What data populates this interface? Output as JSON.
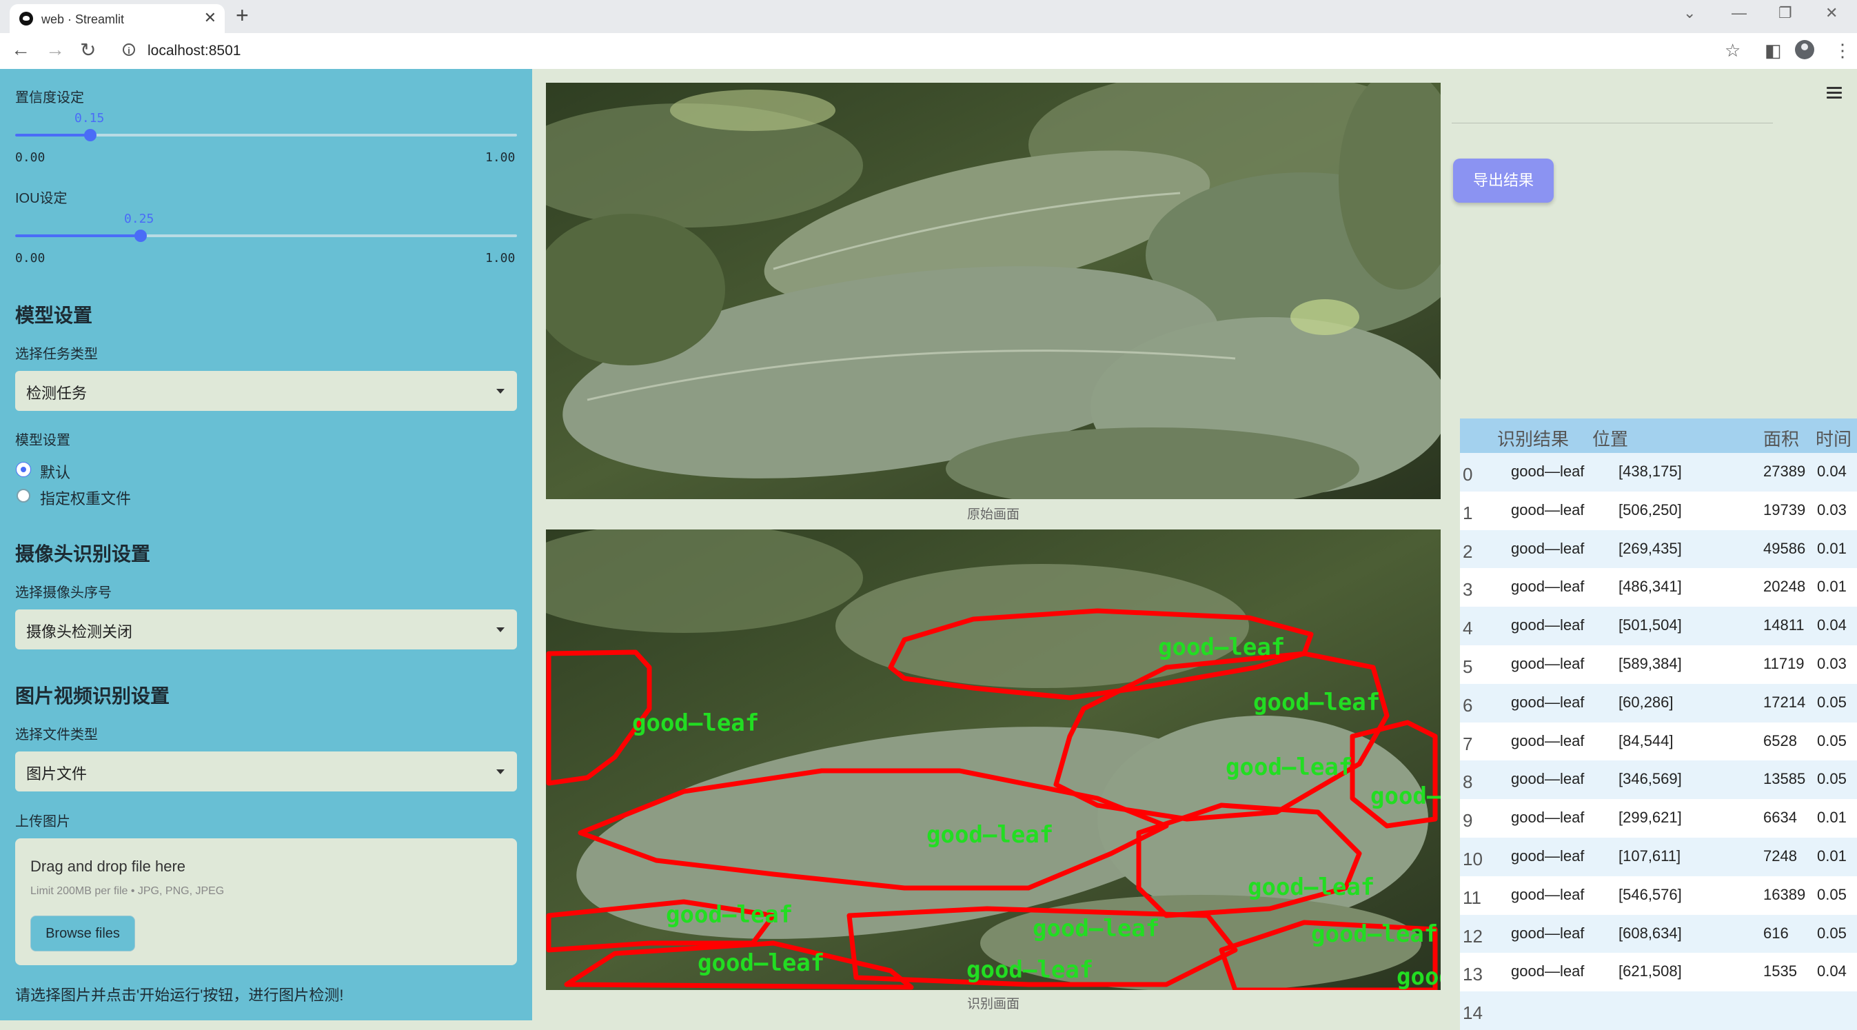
{
  "browser": {
    "tab_title": "web · Streamlit",
    "url": "localhost:8501"
  },
  "sidebar": {
    "confidence": {
      "label": "置信度设定",
      "value": "0.15",
      "value_fraction": 0.15,
      "min": "0.00",
      "max": "1.00"
    },
    "iou": {
      "label": "IOU设定",
      "value": "0.25",
      "value_fraction": 0.25,
      "min": "0.00",
      "max": "1.00"
    },
    "model_section": {
      "title": "模型设置",
      "task_label": "选择任务类型",
      "task_value": "检测任务",
      "model_label": "模型设置",
      "options": [
        "默认",
        "指定权重文件"
      ],
      "selected": 0
    },
    "camera_section": {
      "title": "摄像头识别设置",
      "camera_label": "选择摄像头序号",
      "camera_value": "摄像头检测关闭"
    },
    "media_section": {
      "title": "图片视频识别设置",
      "file_type_label": "选择文件类型",
      "file_type_value": "图片文件",
      "upload_label": "上传图片",
      "dropzone_title": "Drag and drop file here",
      "dropzone_limit": "Limit 200MB per file • JPG, PNG, JPEG",
      "browse_label": "Browse files"
    },
    "status": "请选择图片并点击'开始运行'按钮，进行图片检测!"
  },
  "main": {
    "original_caption": "原始画面",
    "result_caption": "识别画面",
    "export_label": "导出结果",
    "detection_label": "good—leaf",
    "table": {
      "headers": [
        "识别结果",
        "位置",
        "面积",
        "时间"
      ],
      "rows": [
        {
          "idx": "0",
          "label": "good—leaf",
          "pos": "[438,175]",
          "area": "27389",
          "time": "0.04"
        },
        {
          "idx": "1",
          "label": "good—leaf",
          "pos": "[506,250]",
          "area": "19739",
          "time": "0.03"
        },
        {
          "idx": "2",
          "label": "good—leaf",
          "pos": "[269,435]",
          "area": "49586",
          "time": "0.01"
        },
        {
          "idx": "3",
          "label": "good—leaf",
          "pos": "[486,341]",
          "area": "20248",
          "time": "0.01"
        },
        {
          "idx": "4",
          "label": "good—leaf",
          "pos": "[501,504]",
          "area": "14811",
          "time": "0.04"
        },
        {
          "idx": "5",
          "label": "good—leaf",
          "pos": "[589,384]",
          "area": "11719",
          "time": "0.03"
        },
        {
          "idx": "6",
          "label": "good—leaf",
          "pos": "[60,286]",
          "area": "17214",
          "time": "0.05"
        },
        {
          "idx": "7",
          "label": "good—leaf",
          "pos": "[84,544]",
          "area": "6528",
          "time": "0.05"
        },
        {
          "idx": "8",
          "label": "good—leaf",
          "pos": "[346,569]",
          "area": "13585",
          "time": "0.05"
        },
        {
          "idx": "9",
          "label": "good—leaf",
          "pos": "[299,621]",
          "area": "6634",
          "time": "0.01"
        },
        {
          "idx": "10",
          "label": "good—leaf",
          "pos": "[107,611]",
          "area": "7248",
          "time": "0.01"
        },
        {
          "idx": "11",
          "label": "good—leaf",
          "pos": "[546,576]",
          "area": "16389",
          "time": "0.05"
        },
        {
          "idx": "12",
          "label": "good—leaf",
          "pos": "[608,634]",
          "area": "616",
          "time": "0.05"
        },
        {
          "idx": "13",
          "label": "good—leaf",
          "pos": "[621,508]",
          "area": "1535",
          "time": "0.04"
        },
        {
          "idx": "14",
          "label": "",
          "pos": "",
          "area": "",
          "time": ""
        }
      ]
    }
  },
  "colors": {
    "sidebar_bg": "#68bfd4",
    "main_bg": "#dfe8d8",
    "accent": "#4a6cf7",
    "export_button": "#8b93f2",
    "table_header": "#a3d1ee",
    "mask_outline": "#ff0000",
    "mask_label": "#22dd22"
  }
}
